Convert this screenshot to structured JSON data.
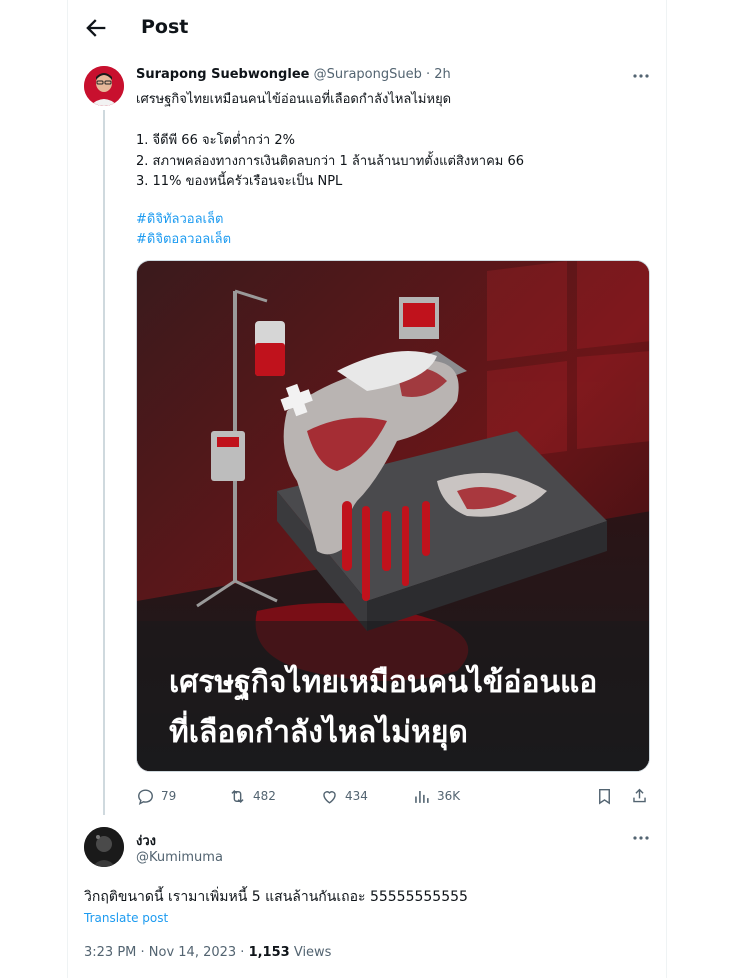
{
  "header": {
    "title": "Post"
  },
  "tweet": {
    "author_name": "Surapong Suebwonglee",
    "author_handle": "@SurapongSueb",
    "time": "· 2h",
    "text": "เศรษฐกิจไทยเหมือนคนไข้อ่อนแอที่เลือดกำลังไหลไม่หยุด\n\n1. จีดีพี 66 จะโตต่ำกว่า 2%\n2. สภาพคล่องทางการเงินติดลบกว่า 1 ล้านล้านบาทตั้งแต่สิงหาคม 66\n3. 11% ของหนี้ครัวเรือนจะเป็น NPL",
    "hashtags": [
      "#ดิจิทัลวอลเล็ต",
      "#ดิจิตอลวอลเล็ต"
    ],
    "media_caption": [
      "เศรษฐกิจไทยเหมือนคนไข้อ่อนแอ",
      "ที่เลือดกำลังไหลไม่หยุด"
    ],
    "stats": {
      "replies": "79",
      "reposts": "482",
      "likes": "434",
      "views": "36K"
    }
  },
  "reply": {
    "author_name": "ง่วง",
    "author_handle": "@Kumimuma",
    "text": "วิกฤติขนาดนี้ เรามาเพิ่มหนี้ 5 แสนล้านกันเถอะ 55555555555",
    "translate": "Translate post",
    "time": "3:23 PM · Nov 14, 2023 · ",
    "views_count": "1,153",
    "views_label": " Views"
  },
  "colors": {
    "accent": "#1d9bf0",
    "blood": "#b0121c",
    "text": "#0f1419",
    "muted": "#536471"
  },
  "icons": [
    "back-arrow-icon",
    "more-icon",
    "reply-icon",
    "repost-icon",
    "like-icon",
    "views-icon",
    "bookmark-icon",
    "share-icon"
  ]
}
